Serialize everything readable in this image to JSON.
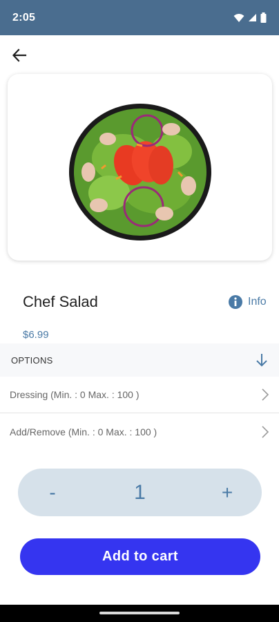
{
  "status": {
    "time": "2:05"
  },
  "product": {
    "name": "Chef Salad",
    "price": "$6.99",
    "info_label": "Info"
  },
  "options": {
    "header": "OPTIONS",
    "items": [
      {
        "label": "Dressing (Min. : 0 Max. : 100 )"
      },
      {
        "label": "Add/Remove (Min. : 0 Max. : 100 )"
      }
    ]
  },
  "quantity": {
    "minus": "-",
    "value": "1",
    "plus": "+"
  },
  "cart": {
    "button_label": "Add to cart"
  },
  "colors": {
    "status_bar": "#4a6d8f",
    "accent": "#4a7aa6",
    "cta": "#3535f0",
    "stepper_bg": "#d6e1ea"
  }
}
